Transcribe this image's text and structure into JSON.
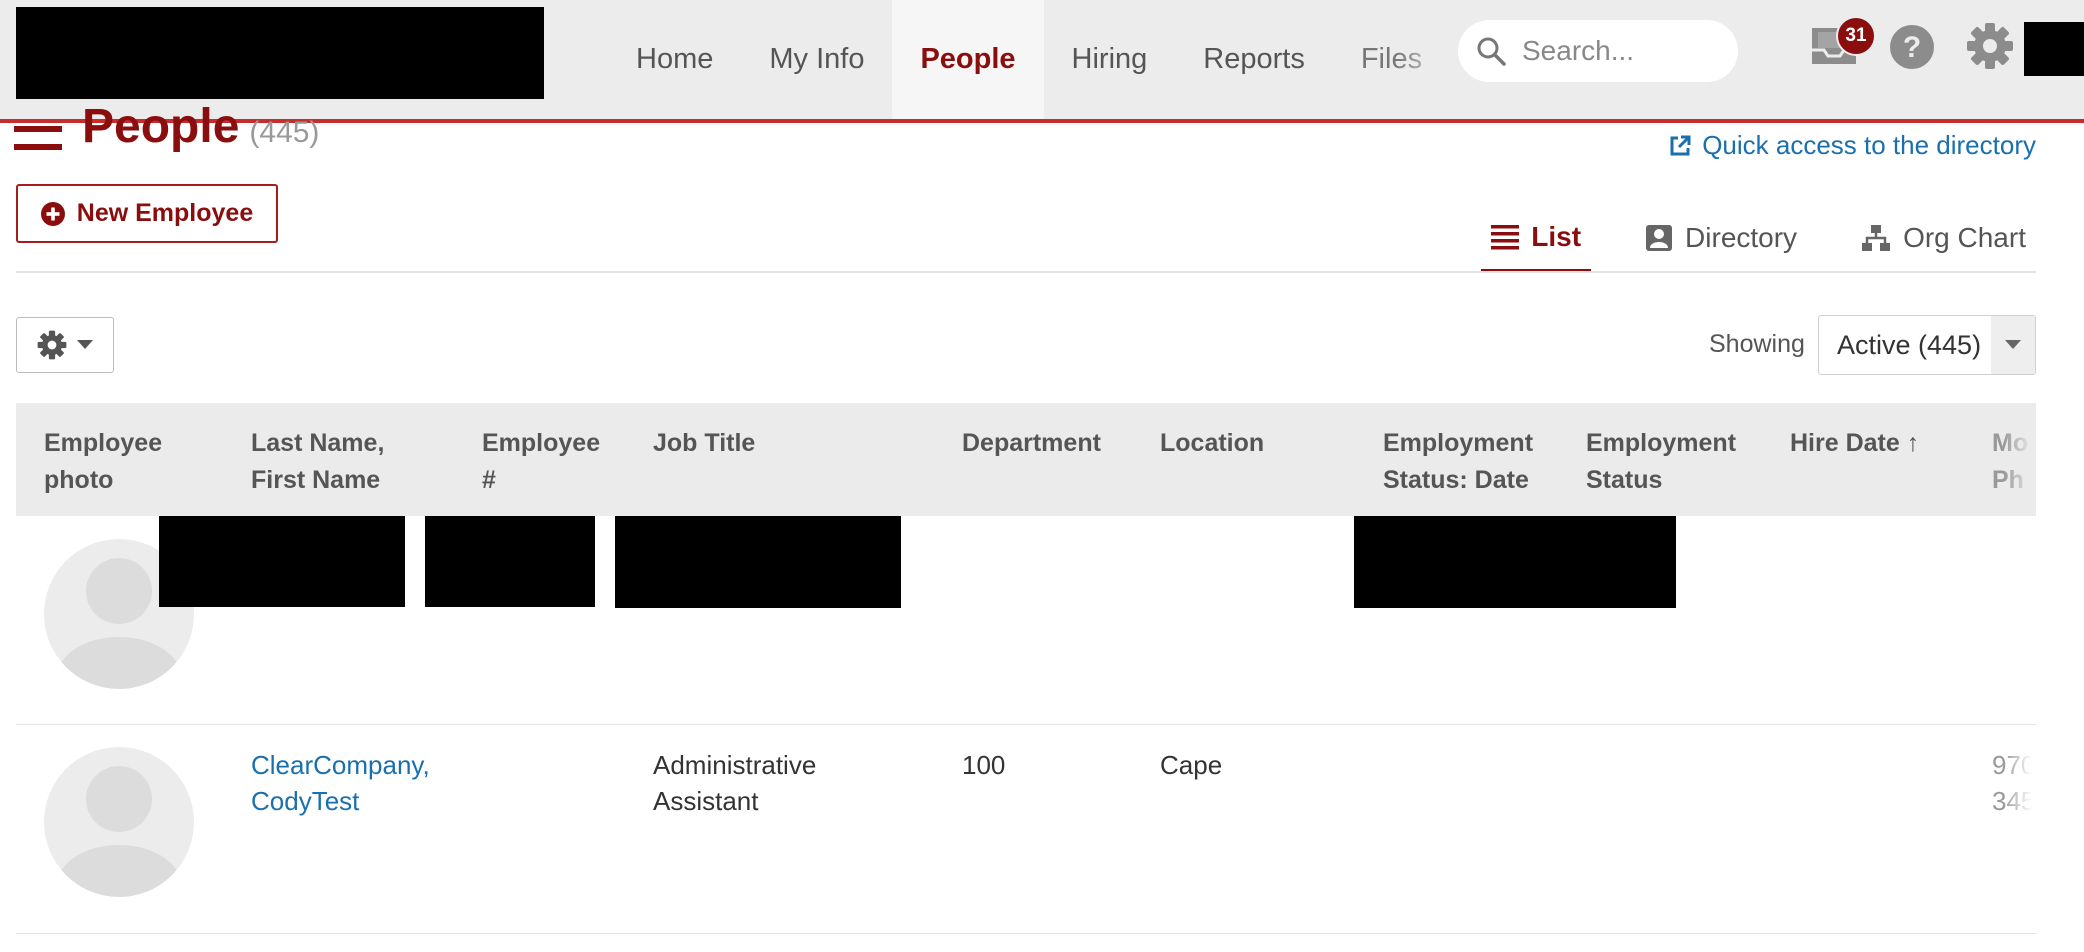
{
  "nav": {
    "items": [
      {
        "label": "Home",
        "active": false
      },
      {
        "label": "My Info",
        "active": false
      },
      {
        "label": "People",
        "active": true
      },
      {
        "label": "Hiring",
        "active": false
      },
      {
        "label": "Reports",
        "active": false
      },
      {
        "label": "Files",
        "active": false
      }
    ],
    "search_placeholder": "Search...",
    "inbox_badge": "31",
    "accent_color": "#8a0e0e"
  },
  "header": {
    "title": "People",
    "count": "(445)",
    "quick_access": "Quick access to the directory",
    "new_employee": "New Employee"
  },
  "view_tabs": [
    {
      "label": "List",
      "icon": "list-icon",
      "active": true
    },
    {
      "label": "Directory",
      "icon": "directory-icon",
      "active": false
    },
    {
      "label": "Org Chart",
      "icon": "org-chart-icon",
      "active": false
    }
  ],
  "toolbar": {
    "showing_label": "Showing",
    "filter_value": "Active (445)"
  },
  "table": {
    "columns": [
      [
        "Employee",
        "photo"
      ],
      [
        "Last Name,",
        "First Name"
      ],
      [
        "Employee",
        "#"
      ],
      [
        "Job Title",
        ""
      ],
      [
        "Department",
        ""
      ],
      [
        "Location",
        ""
      ],
      [
        "Employment",
        "Status: Date"
      ],
      [
        "Employment",
        "Status"
      ],
      [
        "Hire Date ↑",
        ""
      ],
      [
        "Mo",
        "Ph"
      ]
    ],
    "rows": [
      {
        "name_line1": "",
        "name_line2": "",
        "job_line1": "",
        "job_line2": "",
        "department": "",
        "location": "",
        "phone_line1": "",
        "phone_line2": ""
      },
      {
        "name_line1": "ClearCompany,",
        "name_line2": "CodyTest",
        "job_line1": "Administrative",
        "job_line2": "Assistant",
        "department": "100",
        "location": "Cape",
        "phone_line1": "970",
        "phone_line2": "345"
      }
    ]
  }
}
